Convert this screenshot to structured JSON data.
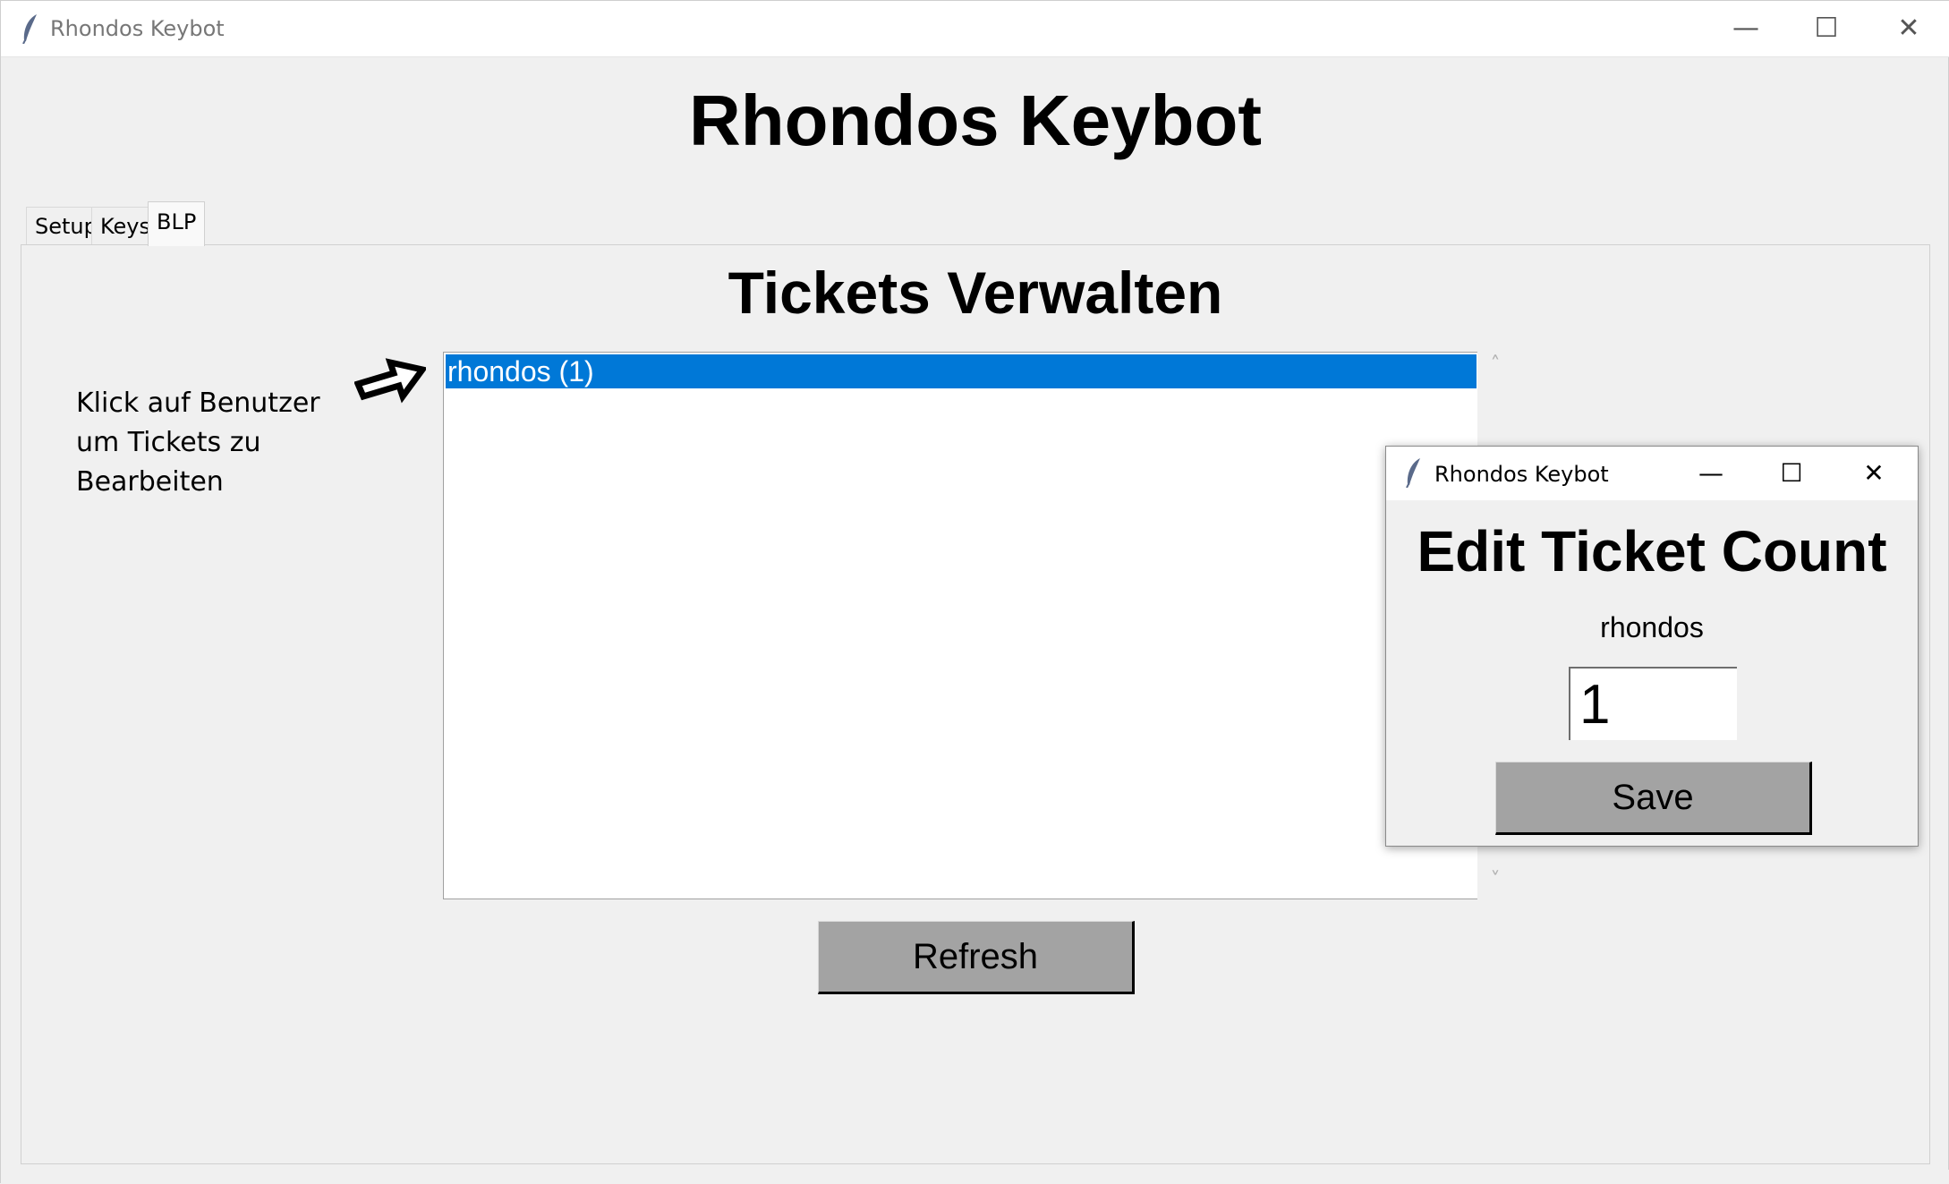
{
  "window": {
    "title": "Rhondos Keybot",
    "app_heading": "Rhondos Keybot",
    "controls": {
      "minimize": "—",
      "maximize": "☐",
      "close": "✕"
    }
  },
  "tabs": [
    {
      "label": "Setup",
      "active": false
    },
    {
      "label": "Keys",
      "active": false
    },
    {
      "label": "BLP",
      "active": true
    }
  ],
  "blp": {
    "heading": "Tickets Verwalten",
    "hint": "Klick auf Benutzer um Tickets zu Bearbeiten",
    "list_items": [
      {
        "label": "rhondos (1)",
        "selected": true
      }
    ],
    "refresh_label": "Refresh",
    "selection_color": "#0078d7",
    "button_color": "#a3a3a3"
  },
  "popup": {
    "title": "Rhondos Keybot",
    "heading": "Edit Ticket Count",
    "username": "rhondos",
    "count_value": "1",
    "save_label": "Save"
  }
}
